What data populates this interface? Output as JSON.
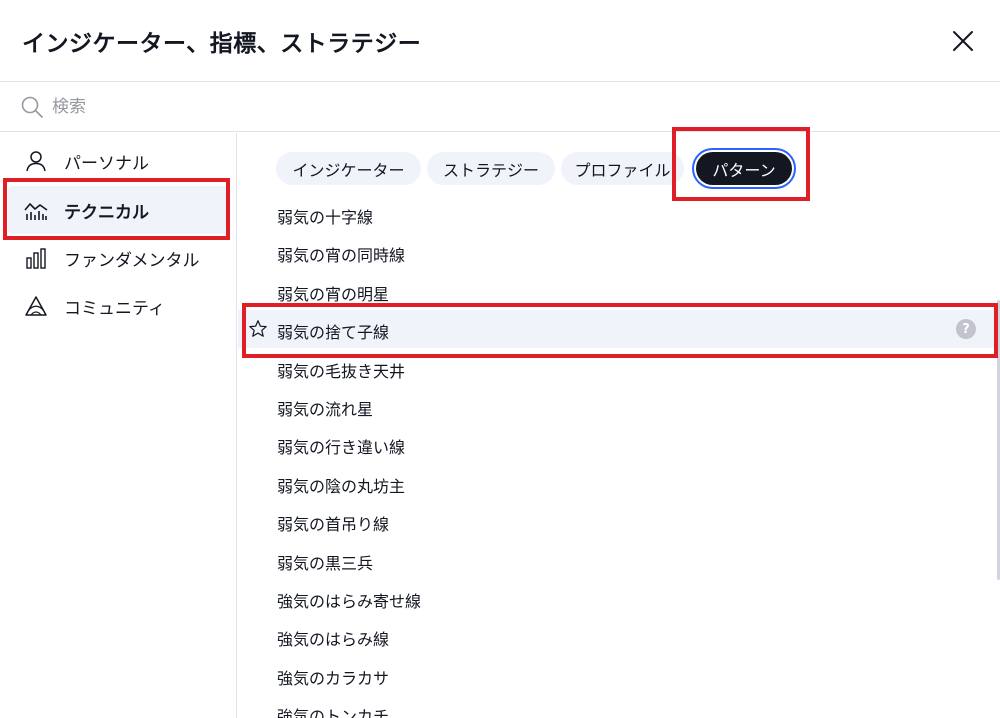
{
  "header": {
    "title": "インジケーター、指標、ストラテジー"
  },
  "search": {
    "placeholder": "検索"
  },
  "sidebar": {
    "items": [
      {
        "label": "パーソナル",
        "icon": "person-icon"
      },
      {
        "label": "テクニカル",
        "icon": "technical-chart-icon",
        "active": true
      },
      {
        "label": "ファンダメンタル",
        "icon": "bar-chart-icon"
      },
      {
        "label": "コミュニティ",
        "icon": "community-icon"
      }
    ]
  },
  "tabs": [
    {
      "label": "インジケーター"
    },
    {
      "label": "ストラテジー"
    },
    {
      "label": "プロファイル"
    },
    {
      "label": "パターン",
      "active": true
    }
  ],
  "patterns": [
    "弱気の十字線",
    "弱気の宵の同時線",
    "弱気の宵の明星",
    "弱気の捨て子線",
    "弱気の毛抜き天井",
    "弱気の流れ星",
    "弱気の行き違い線",
    "弱気の陰の丸坊主",
    "弱気の首吊り線",
    "弱気の黒三兵",
    "強気のはらみ寄せ線",
    "強気のはらみ線",
    "強気のカラカサ",
    "強気のトンカチ"
  ],
  "help_glyph": "?",
  "colors": {
    "highlight": "#e01e26",
    "active_chip": "#131722",
    "focus_ring": "#2962ff",
    "hover_bg": "#f0f3fa"
  }
}
